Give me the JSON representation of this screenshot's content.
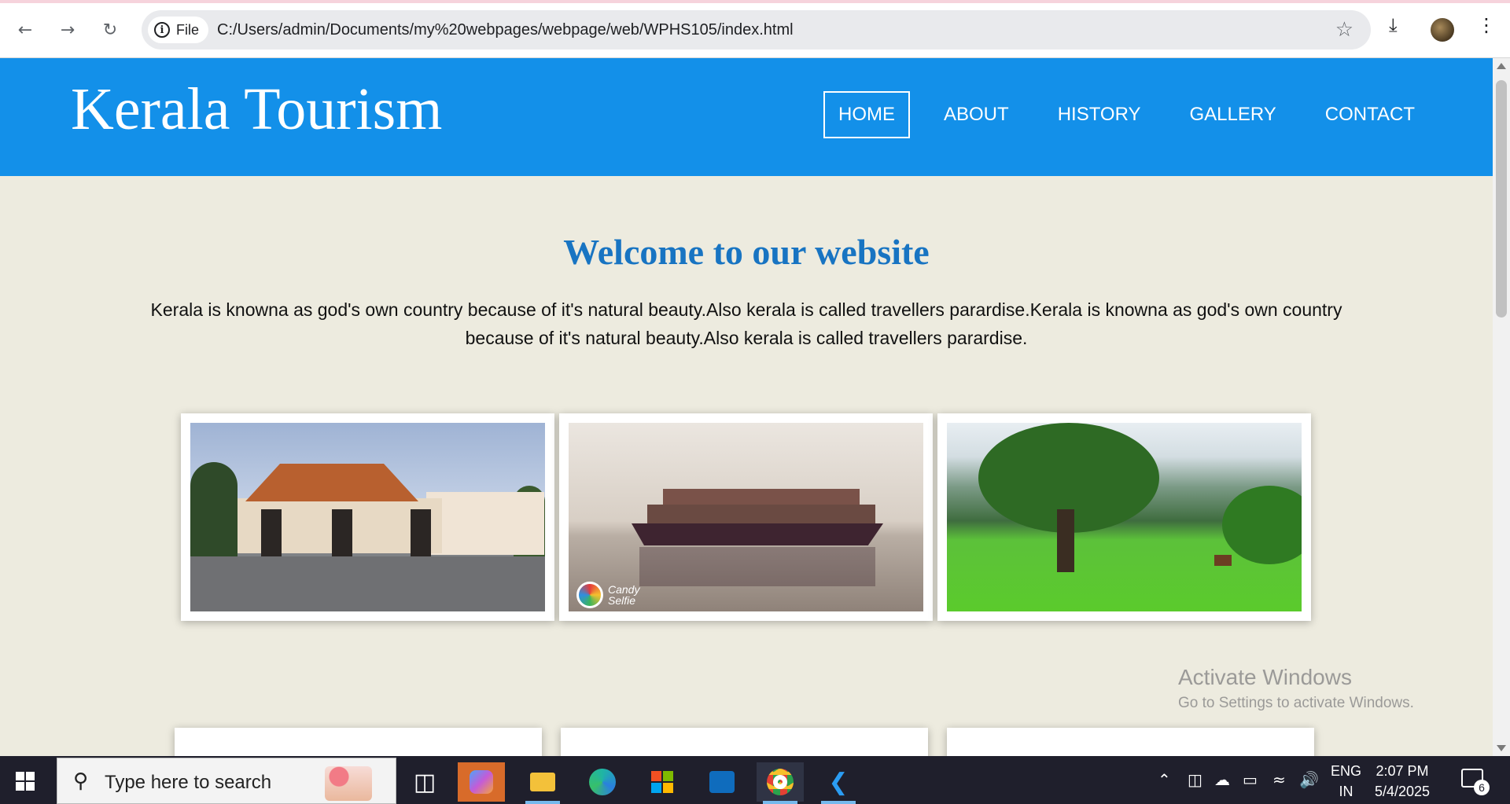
{
  "browser": {
    "back_icon": "arrow-left-icon",
    "forward_icon": "arrow-right-icon",
    "reload_icon": "reload-icon",
    "site_chip_label": "File",
    "url": "C:/Users/admin/Documents/my%20webpages/webpage/web/WPHS105/index.html",
    "bookmark_icon": "star-icon",
    "download_icon": "download-icon",
    "menu_icon": "kebab-menu-icon"
  },
  "site": {
    "title": "Kerala Tourism",
    "nav": [
      "HOME",
      "ABOUT",
      "HISTORY",
      "GALLERY",
      "CONTACT"
    ],
    "active_nav": "HOME",
    "header_color": "#1390e9",
    "background_color": "#edebdf"
  },
  "main": {
    "heading": "Welcome to our website",
    "intro": "Kerala is knowna as god's own country because of it's natural beauty.Also kerala is called travellers parardise.Kerala is knowna as god's own country because of it's natural beauty.Also kerala is called travellers parardise.",
    "photos": [
      {
        "subject": "Government building with traditional Kerala roof"
      },
      {
        "subject": "Houseboat on backwaters",
        "watermark": "Candy Selfie"
      },
      {
        "subject": "Green meadow with large tree and hills"
      }
    ]
  },
  "watermark": {
    "line1": "Activate Windows",
    "line2": "Go to Settings to activate Windows."
  },
  "taskbar": {
    "search_placeholder": "Type here to search",
    "language": "ENG",
    "region": "IN",
    "time": "2:07 PM",
    "date": "5/4/2025",
    "notification_count": "6"
  }
}
